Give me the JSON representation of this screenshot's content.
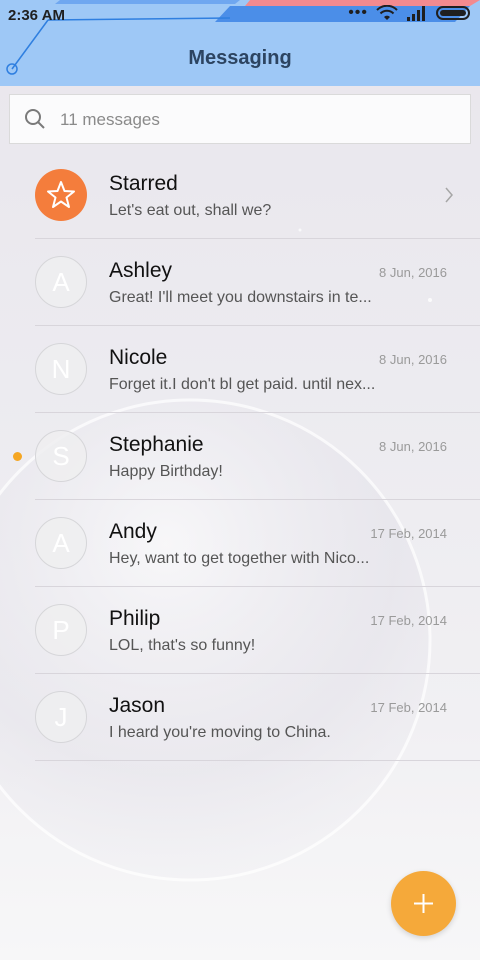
{
  "status_bar": {
    "time": "2:36 AM"
  },
  "header": {
    "title": "Messaging"
  },
  "search": {
    "placeholder": "11 messages"
  },
  "threads": [
    {
      "initial": "",
      "name": "Starred",
      "preview": "Let's eat out, shall we?",
      "date": "",
      "starred": true
    },
    {
      "initial": "A",
      "name": "Ashley",
      "preview": "Great! I'll meet you downstairs in te...",
      "date": "8 Jun, 2016"
    },
    {
      "initial": "N",
      "name": "Nicole",
      "preview": "Forget it.I don't bl get paid. until nex...",
      "date": "8 Jun, 2016"
    },
    {
      "initial": "S",
      "name": "Stephanie",
      "preview": "Happy Birthday!",
      "date": "8 Jun, 2016",
      "unread": true
    },
    {
      "initial": "A",
      "name": "Andy",
      "preview": "Hey, want to get together with Nico...",
      "date": "17 Feb, 2014"
    },
    {
      "initial": "P",
      "name": "Philip",
      "preview": "LOL, that's so funny!",
      "date": "17 Feb, 2014"
    },
    {
      "initial": "J",
      "name": "Jason",
      "preview": "I heard you're moving to China.",
      "date": "17 Feb, 2014"
    }
  ],
  "colors": {
    "header_bg": "#9ec8f6",
    "starred_avatar": "#f47d3c",
    "unread_dot": "#f5a623",
    "fab": "#f5a93a"
  },
  "icons": {
    "search": "search-icon",
    "fab": "plus-icon",
    "star": "star-icon",
    "chevron": "chevron-right-icon"
  }
}
